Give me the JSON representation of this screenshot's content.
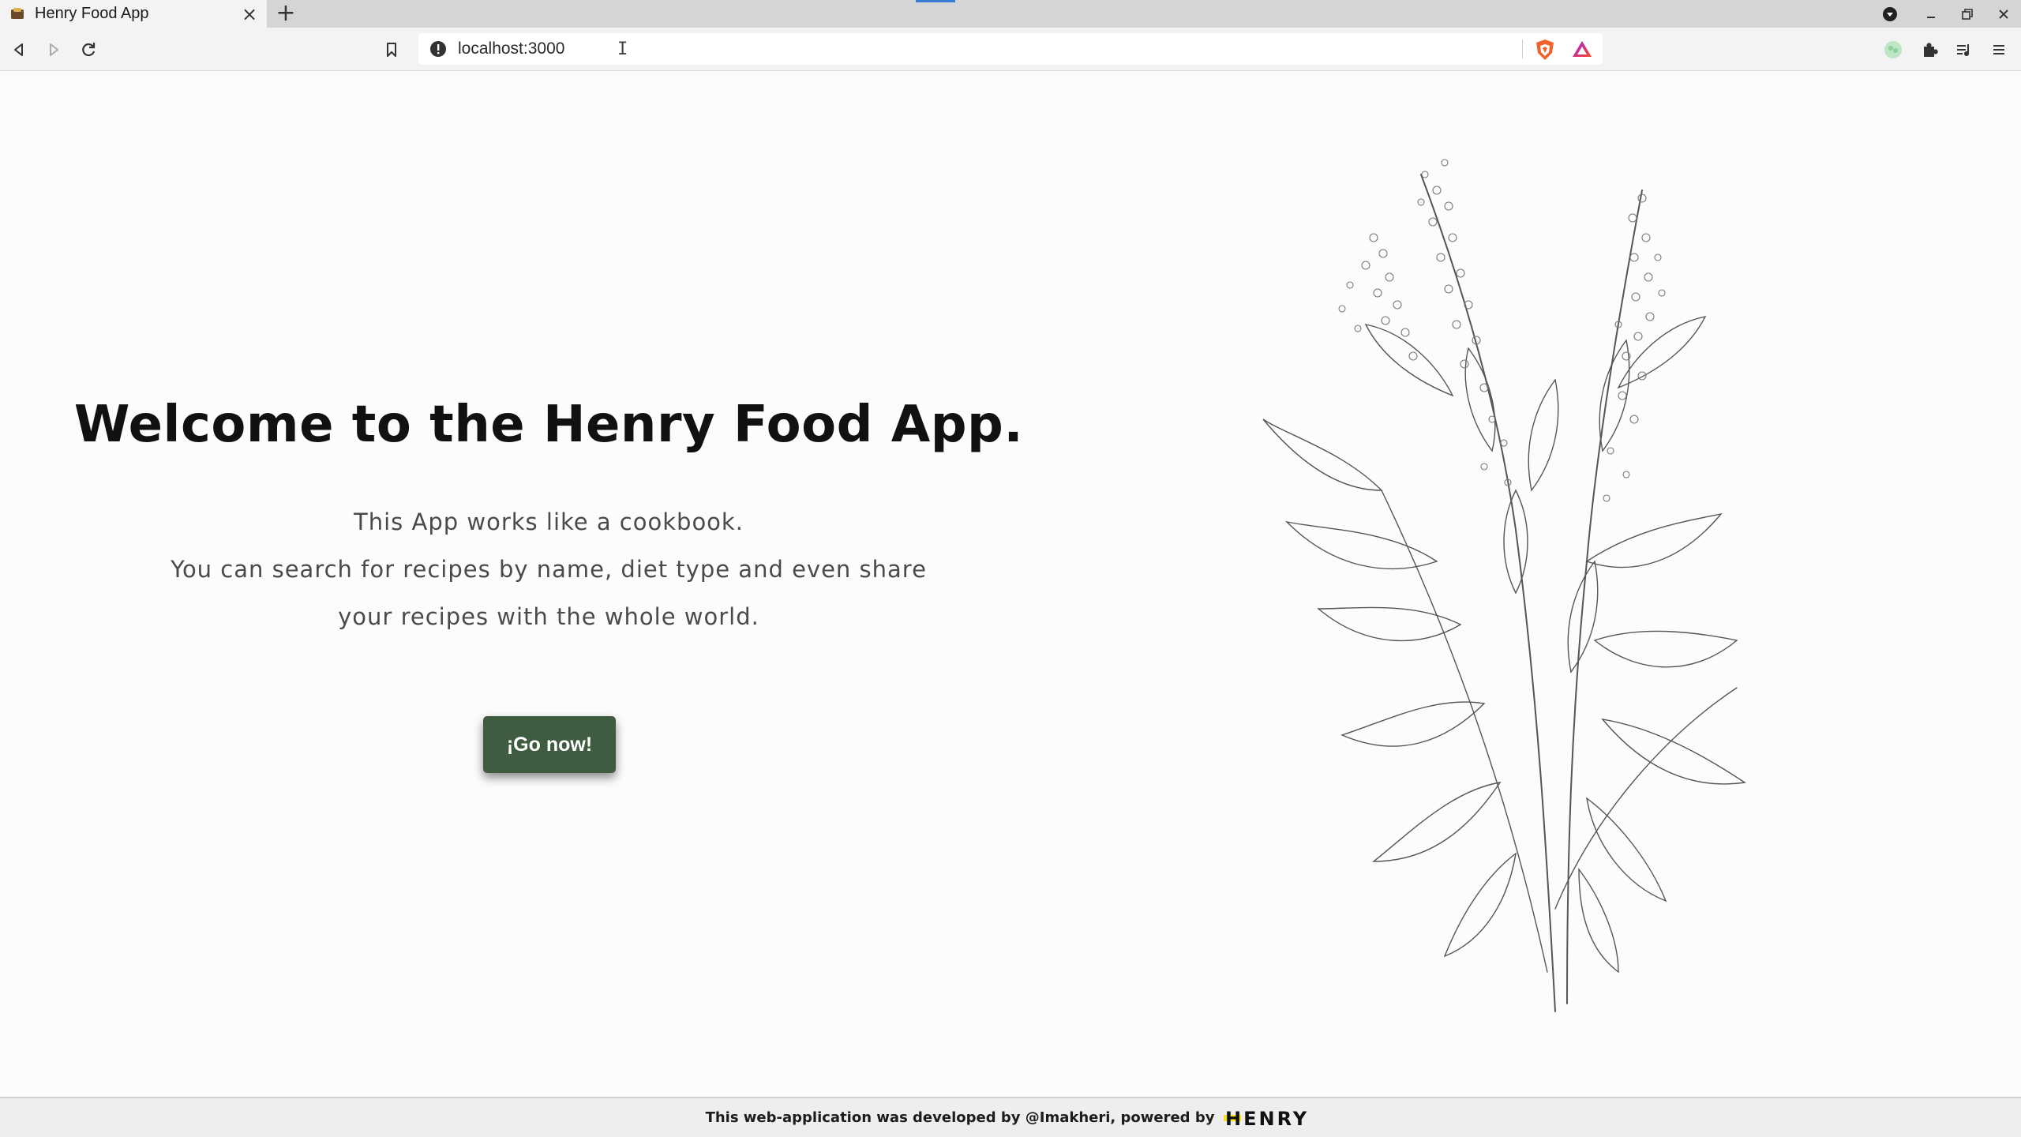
{
  "browser": {
    "tab_title": "Henry Food App",
    "tab_close": "×",
    "new_tab": "+",
    "url": "localhost:3000",
    "text_cursor": "I"
  },
  "hero": {
    "headline": "Welcome to the Henry Food App.",
    "intro_lines": [
      "This App works like a cookbook.",
      "You can search for recipes by name, diet type and even share",
      "your recipes with the whole world."
    ],
    "cta_label": "¡Go now!",
    "illustration": "quinoa-plant-sketch-illustration"
  },
  "footer": {
    "credit": "This web-application was developed by @Imakheri, powered by",
    "logo_text": "HENRY"
  },
  "colors": {
    "page_bg": "#fcfcfb",
    "cta_bg": "#3f5c41",
    "headline": "#111111",
    "body_text": "#4a4a4a"
  },
  "icons": [
    "back-icon",
    "forward-icon",
    "reload-icon",
    "bookmark-icon",
    "site-info-icon",
    "brave-shields-icon",
    "brave-rewards-icon",
    "profile-icon",
    "extensions-icon",
    "media-icon",
    "menu-icon"
  ]
}
